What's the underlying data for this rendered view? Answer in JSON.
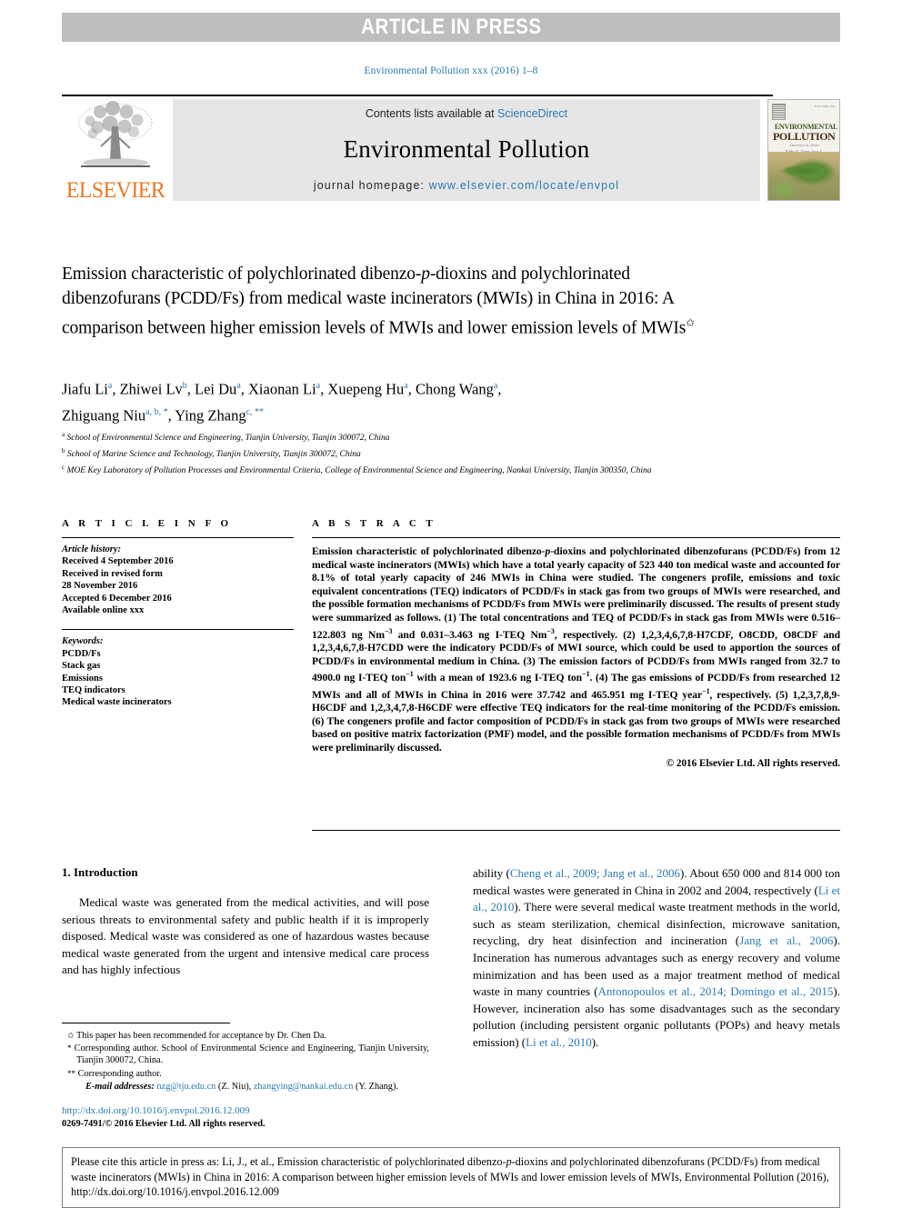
{
  "banner": {
    "text": "ARTICLE IN PRESS",
    "background": "#bcbec0",
    "text_color": "#ffffff"
  },
  "journal_ref": "Environmental Pollution xxx (2016) 1–8",
  "masthead": {
    "publisher_logo_label": "ELSEVIER",
    "contents_prefix": "Contents lists available at ",
    "contents_link": "ScienceDirect",
    "journal_title": "Environmental Pollution",
    "homepage_prefix": "journal homepage: ",
    "homepage_url": "www.elsevier.com/locate/envpol",
    "cover": {
      "line1": "ENVIRONMENTAL",
      "line2": "POLLUTION",
      "issn_note": "ISSN 0269-7491",
      "sub1": "EDITORS-IN-CHIEF",
      "sub2": "Eddy Y. Zeng   Jose L. Domingo"
    }
  },
  "title": {
    "text": "Emission characteristic of polychlorinated dibenzo-p-dioxins and polychlorinated dibenzofurans (PCDD/Fs) from medical waste incinerators (MWIs) in China in 2016: A comparison between higher emission levels of MWIs and lower emission levels of MWIs",
    "italic_token": "p",
    "marker": "✩"
  },
  "authors": [
    {
      "name": "Jiafu Li",
      "marks": "a"
    },
    {
      "name": "Zhiwei Lv",
      "marks": "b"
    },
    {
      "name": "Lei Du",
      "marks": "a"
    },
    {
      "name": "Xiaonan Li",
      "marks": "a"
    },
    {
      "name": "Xuepeng Hu",
      "marks": "a"
    },
    {
      "name": "Chong Wang",
      "marks": "a"
    },
    {
      "name": "Zhiguang Niu",
      "marks": "a, b, *"
    },
    {
      "name": "Ying Zhang",
      "marks": "c, **"
    }
  ],
  "affiliations": [
    {
      "mark": "a",
      "text": "School of Environmental Science and Engineering, Tianjin University, Tianjin 300072, China"
    },
    {
      "mark": "b",
      "text": "School of Marine Science and Technology, Tianjin University, Tianjin 300072, China"
    },
    {
      "mark": "c",
      "text": "MOE Key Laboratory of Pollution Processes and Environmental Criteria, College of Environmental Science and Engineering, Nankai University, Tianjin 300350, China"
    }
  ],
  "article_info": {
    "heading": "A R T I C L E  I N F O",
    "history_label": "Article history:",
    "history": [
      "Received 4 September 2016",
      "Received in revised form",
      "28 November 2016",
      "Accepted 6 December 2016",
      "Available online xxx"
    ],
    "keywords_label": "Keywords:",
    "keywords": [
      "PCDD/Fs",
      "Stack gas",
      "Emissions",
      "TEQ indicators",
      "Medical waste incinerators"
    ]
  },
  "abstract": {
    "heading": "A B S T R A C T",
    "text": "Emission characteristic of polychlorinated dibenzo-p-dioxins and polychlorinated dibenzofurans (PCDD/Fs) from 12 medical waste incinerators (MWIs) which have a total yearly capacity of 523 440 ton medical waste and accounted for 8.1% of total yearly capacity of 246 MWIs in China were studied. The congeners profile, emissions and toxic equivalent concentrations (TEQ) indicators of PCDD/Fs in stack gas from two groups of MWIs were researched, and the possible formation mechanisms of PCDD/Fs from MWIs were preliminarily discussed. The results of present study were summarized as follows. (1) The total concentrations and TEQ of PCDD/Fs in stack gas from MWIs were 0.516–122.803 ng Nm⁻³ and 0.031–3.463 ng I-TEQ Nm⁻³, respectively. (2) 1,2,3,4,6,7,8-H7CDF, O8CDD, O8CDF and 1,2,3,4,6,7,8-H7CDD were the indicatory PCDD/Fs of MWI source, which could be used to apportion the sources of PCDD/Fs in environmental medium in China. (3) The emission factors of PCDD/Fs from MWIs ranged from 32.7 to 4900.0 ng I-TEQ ton⁻¹ with a mean of 1923.6 ng I-TEQ ton⁻¹. (4) The gas emissions of PCDD/Fs from researched 12 MWIs and all of MWIs in China in 2016 were 37.742 and 465.951 mg I-TEQ year⁻¹, respectively. (5) 1,2,3,7,8,9-H6CDF and 1,2,3,4,7,8-H6CDF were effective TEQ indicators for the real-time monitoring of the PCDD/Fs emission. (6) The congeners profile and factor composition of PCDD/Fs in stack gas from two groups of MWIs were researched based on positive matrix factorization (PMF) model, and the possible formation mechanisms of PCDD/Fs from MWIs were preliminarily discussed.",
    "copyright": "© 2016 Elsevier Ltd. All rights reserved."
  },
  "body": {
    "section_number_title": "1. Introduction",
    "left_paragraph": "Medical waste was generated from the medical activities, and will pose serious threats to environmental safety and public health if it is improperly disposed. Medical waste was considered as one of hazardous wastes because medical waste generated from the urgent and intensive medical care process and has highly infectious",
    "right_paragraph_parts": [
      {
        "t": "ability (",
        "link": false
      },
      {
        "t": "Cheng et al., 2009; Jang et al., 2006",
        "link": true
      },
      {
        "t": "). About 650 000 and 814 000 ton medical wastes were generated in China in 2002 and 2004, respectively (",
        "link": false
      },
      {
        "t": "Li et al., 2010",
        "link": true
      },
      {
        "t": "). There were several medical waste treatment methods in the world, such as steam sterilization, chemical disinfection, microwave sanitation, recycling, dry heat disinfection and incineration (",
        "link": false
      },
      {
        "t": "Jang et al., 2006",
        "link": true
      },
      {
        "t": "). Incineration has numerous advantages such as energy recovery and volume minimization and has been used as a major treatment method of medical waste in many countries (",
        "link": false
      },
      {
        "t": "Antonopoulos et al., 2014; Domingo et al., 2015",
        "link": true
      },
      {
        "t": "). However, incineration also has some disadvantages such as the secondary pollution (including persistent organic pollutants (POPs) and heavy metals emission) (",
        "link": false
      },
      {
        "t": "Li et al., 2010",
        "link": true
      },
      {
        "t": ").",
        "link": false
      }
    ]
  },
  "footnotes": {
    "star": {
      "mark": "✩",
      "text": "This paper has been recommended for acceptance by Dr. Chen Da."
    },
    "corresponding1": {
      "mark": "*",
      "text": "Corresponding author. School of Environmental Science and Engineering, Tianjin University, Tianjin 300072, China."
    },
    "corresponding2": {
      "mark": "**",
      "text": "Corresponding author."
    },
    "email_label": "E-mail addresses:",
    "email1": "nzg@tju.edu.cn",
    "email1_name": "(Z. Niu),",
    "email2": "zhangying@nankai.edu.cn",
    "email2_name": "(Y. Zhang)."
  },
  "doi": "http://dx.doi.org/10.1016/j.envpol.2016.12.009",
  "issn": "0269-7491/© 2016 Elsevier Ltd. All rights reserved.",
  "citation_box": {
    "text": "Please cite this article in press as: Li, J., et al., Emission characteristic of polychlorinated dibenzo-p-dioxins and polychlorinated dibenzofurans (PCDD/Fs) from medical waste incinerators (MWIs) in China in 2016: A comparison between higher emission levels of MWIs and lower emission levels of MWIs, Environmental Pollution (2016), http://dx.doi.org/10.1016/j.envpol.2016.12.009"
  },
  "colors": {
    "link": "#2a7ab0",
    "banner_grey": "#bcbec0",
    "panel_grey": "#e6e6e6",
    "elsevier_orange": "#e87722"
  }
}
